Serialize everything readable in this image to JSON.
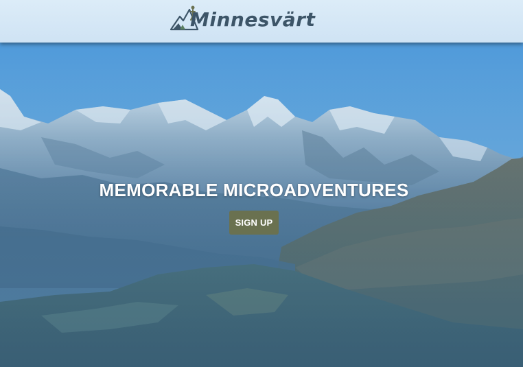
{
  "navbar": {
    "logo_text": "Minnesvärt"
  },
  "hero": {
    "title": "MEMORABLE MICROADVENTURES",
    "signup_label": "SIGN UP"
  },
  "colors": {
    "navbar_bg": "#d3e6f5",
    "logo_text": "#3d5568",
    "button_bg": "#6a7150",
    "title_text": "#ffffff",
    "sky": "#4f9ad8"
  },
  "icons": {
    "logo": "mountain-hiker-icon"
  }
}
